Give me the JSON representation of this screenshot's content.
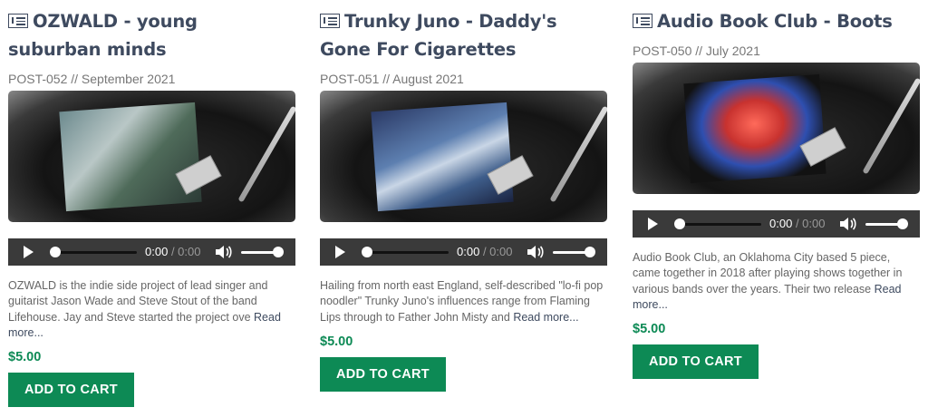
{
  "products": [
    {
      "title": "OZWALD - young suburban minds",
      "meta": "POST-052 // September 2021",
      "time_current": "0:00",
      "time_duration": "0:00",
      "description": "OZWALD is the indie side project of lead singer and guitarist Jason Wade and Steve Stout of the band Lifehouse. Jay and Steve started the project ove",
      "read_more": "Read more...",
      "price": "$5.00",
      "button": "ADD TO CART"
    },
    {
      "title": "Trunky Juno - Daddy's Gone For Cigarettes",
      "meta": "POST-051 // August 2021",
      "time_current": "0:00",
      "time_duration": "0:00",
      "description": "Hailing from north east England, self-described \"lo-fi pop noodler\" Trunky Juno's influences range from Flaming Lips through to Father John Misty and",
      "read_more": "Read more...",
      "price": "$5.00",
      "button": "ADD TO CART"
    },
    {
      "title": "Audio Book Club - Boots",
      "meta": "POST-050 // July 2021",
      "time_current": "0:00",
      "time_duration": "0:00",
      "description": "Audio Book Club, an Oklahoma City based 5 piece, came together in 2018 after playing shows together in various bands over the years. Their two release",
      "read_more": "Read more...",
      "price": "$5.00",
      "button": "ADD TO CART"
    }
  ],
  "icons": {
    "post": "post-icon",
    "play": "play-icon",
    "volume": "volume-icon"
  },
  "colors": {
    "title": "#3e4a5f",
    "accent": "#0d8a55",
    "player_bg": "#3a3a3a"
  }
}
